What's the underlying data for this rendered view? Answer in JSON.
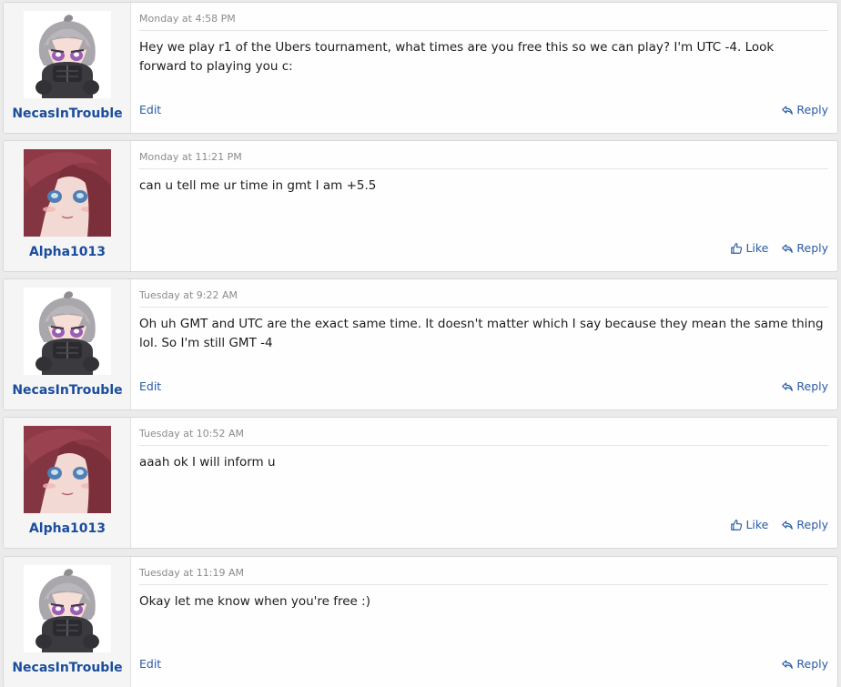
{
  "posts": [
    {
      "username": "NecasInTrouble",
      "avatar": "necas-avatar",
      "date": "Monday at 4:58 PM",
      "body": "Hey we play r1 of the Ubers tournament, what times are you free this so we can play? I'm UTC -4. Look forward to playing you c:",
      "edit_label": "Edit",
      "reply_label": "Reply"
    },
    {
      "username": "Alpha1013",
      "avatar": "alpha-avatar",
      "date": "Monday at 11:21 PM",
      "body": "can u tell me ur time in gmt I am +5.5",
      "like_label": "Like",
      "reply_label": "Reply"
    },
    {
      "username": "NecasInTrouble",
      "avatar": "necas-avatar",
      "date": "Tuesday at 9:22 AM",
      "body": "Oh uh GMT and UTC are the exact same time. It doesn't matter which I say because they mean the same thing lol. So I'm still GMT -4",
      "edit_label": "Edit",
      "reply_label": "Reply"
    },
    {
      "username": "Alpha1013",
      "avatar": "alpha-avatar",
      "date": "Tuesday at 10:52 AM",
      "body": "aaah ok I will inform u",
      "like_label": "Like",
      "reply_label": "Reply"
    },
    {
      "username": "NecasInTrouble",
      "avatar": "necas-avatar",
      "date": "Tuesday at 11:19 AM",
      "body": "Okay let me know when you're free :)",
      "edit_label": "Edit",
      "reply_label": "Reply"
    }
  ],
  "colors": {
    "username": "#1a4d9c",
    "link": "#2a5ba6",
    "date": "#8c8c8c",
    "user_cell_bg": "#f5f5f5",
    "page_bg": "#ebebeb"
  }
}
